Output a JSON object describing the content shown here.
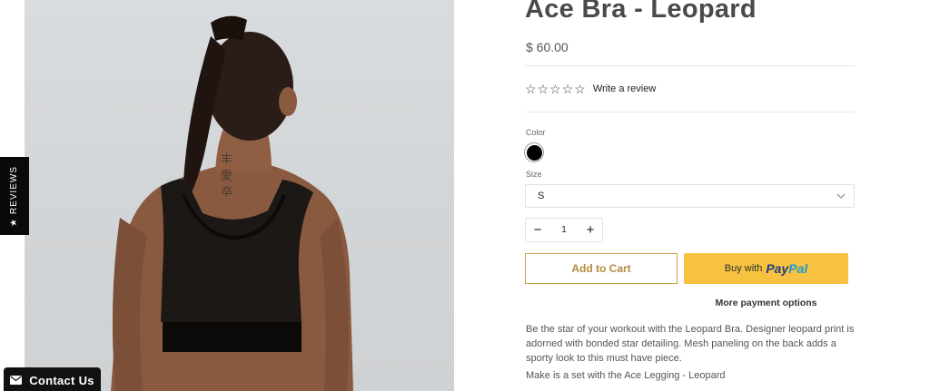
{
  "product": {
    "title": "Ace Bra - Leopard",
    "price": "$ 60.00",
    "write_review": "Write a review",
    "stars": [
      "☆",
      "☆",
      "☆",
      "☆",
      "☆"
    ],
    "color_label": "Color",
    "color_value_hex": "#000000",
    "size_label": "Size",
    "size_selected": "S",
    "quantity": "1",
    "add_to_cart": "Add to Cart",
    "buy_with": "Buy with",
    "paypal_pay": "Pay",
    "paypal_pal": "Pal",
    "more_payment": "More payment options",
    "description": "Be the star of your workout with the Leopard Bra.   Designer leopard print is adorned with bonded star detailing.   Mesh paneling on the back adds a sporty look to this must have piece.",
    "set_note": "Make is a set with the Ace Legging - Leopard"
  },
  "widgets": {
    "reviews_tab": "REVIEWS",
    "reviews_star": "★",
    "contact_us": "Contact Us"
  },
  "icons": {
    "minus": "−",
    "plus": "+"
  },
  "colors": {
    "accent_gold": "#c9a04f",
    "paypal_yellow": "#f7c240",
    "paypal_navy": "#253b80",
    "paypal_blue": "#179bd7"
  }
}
